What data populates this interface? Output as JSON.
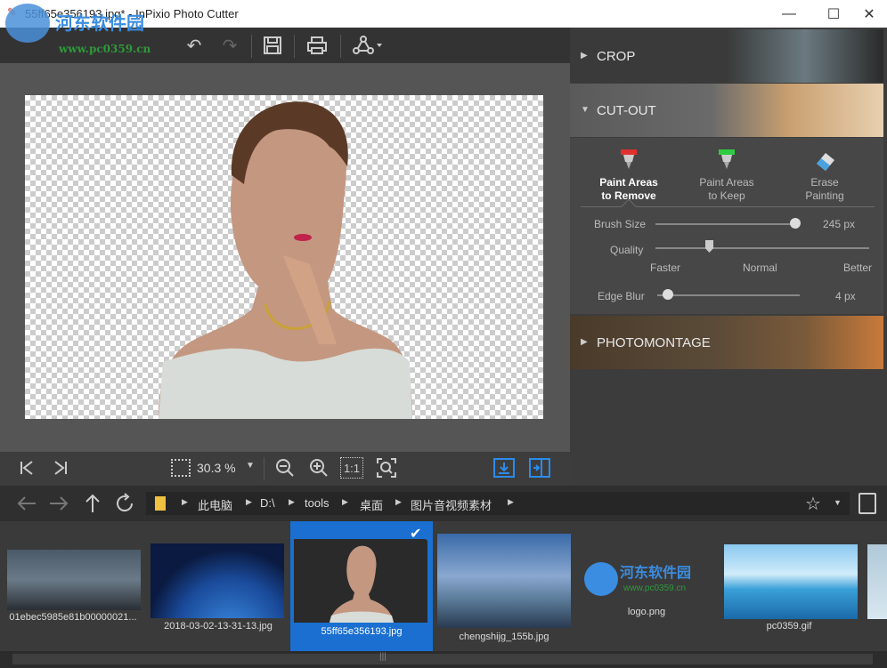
{
  "window": {
    "title": "55ff65e356193.jpg* - InPixio Photo Cutter",
    "minimize": "—",
    "maximize": "☐",
    "close": "✕"
  },
  "watermark": {
    "name": "河东软件园",
    "url": "www.pc0359.cn"
  },
  "toolbar": {
    "undo": "↶",
    "redo": "↷",
    "save": "💾",
    "print": "🖶",
    "share": "⚲"
  },
  "viewbar": {
    "zoom": "30.3 %",
    "fit_label": "1:1"
  },
  "sections": {
    "crop": "CROP",
    "cutout": "CUT-OUT",
    "photomontage": "PHOTOMONTAGE"
  },
  "tools": [
    {
      "line1": "Paint Areas",
      "line2": "to Remove",
      "color": "#d33"
    },
    {
      "line1": "Paint Areas",
      "line2": "to Keep",
      "color": "#3c3"
    },
    {
      "line1": "Erase",
      "line2": "Painting",
      "color": "#5ad"
    }
  ],
  "settings": {
    "brush_size_label": "Brush Size",
    "brush_size_value": "245 px",
    "brush_size_level": 0.98,
    "quality_label": "Quality",
    "quality_faster": "Faster",
    "quality_normal": "Normal",
    "quality_better": "Better",
    "quality_level": 0.25,
    "edge_blur_label": "Edge Blur",
    "edge_blur_value": "4 px",
    "edge_blur_level": 0.04
  },
  "path": [
    "此电脑",
    "D:\\",
    "tools",
    "桌面",
    "图片音视频素材"
  ],
  "files": [
    {
      "name": "01ebec5985e81b00000021...",
      "selected": false
    },
    {
      "name": "2018-03-02-13-31-13.jpg",
      "selected": false
    },
    {
      "name": "55ff65e356193.jpg",
      "selected": true
    },
    {
      "name": "chengshijg_155b.jpg",
      "selected": false
    },
    {
      "name": "logo.png",
      "selected": false
    },
    {
      "name": "pc0359.gif",
      "selected": false
    }
  ],
  "logo_thumb": {
    "name": "河东软件园",
    "url": "www.pc0359.cn"
  },
  "colors": {
    "accent": "#1a6fd1",
    "panel": "#3c3c3c"
  }
}
